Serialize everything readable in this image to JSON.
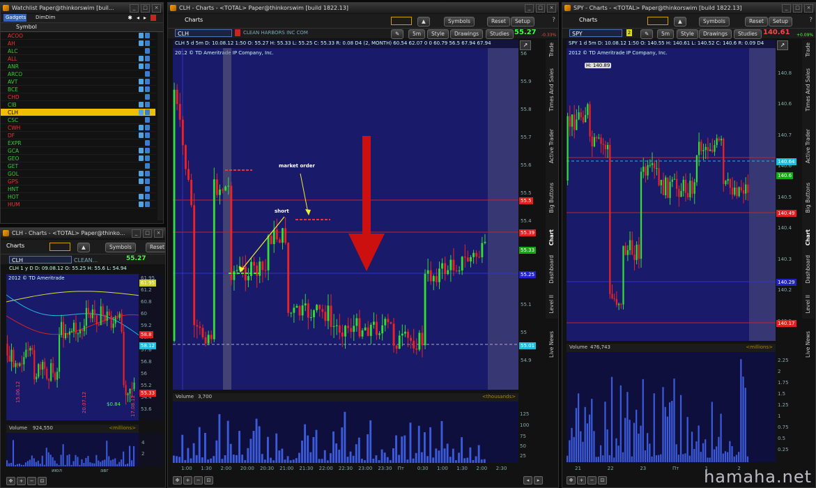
{
  "watchlist": {
    "title": "Watchlist Paper@thinkorswim [buil...",
    "gadgets_label": "Gadgets",
    "dimdim_label": "DimDim",
    "header": "Symbol",
    "rows": [
      {
        "sym": "ACOO",
        "color": "#e33"
      },
      {
        "sym": "AH",
        "color": "#e33"
      },
      {
        "sym": "ALC",
        "color": "#3c3"
      },
      {
        "sym": "ALL",
        "color": "#e33"
      },
      {
        "sym": "ANR",
        "color": "#3c3"
      },
      {
        "sym": "ARCO",
        "color": "#3c3"
      },
      {
        "sym": "AVT",
        "color": "#3c3"
      },
      {
        "sym": "BCE",
        "color": "#3c3"
      },
      {
        "sym": "CHD",
        "color": "#e33"
      },
      {
        "sym": "CIB",
        "color": "#3c3"
      },
      {
        "sym": "CLH",
        "color": "#000",
        "selected": true
      },
      {
        "sym": "CSC",
        "color": "#3c3"
      },
      {
        "sym": "CWH",
        "color": "#e33"
      },
      {
        "sym": "DF",
        "color": "#e33"
      },
      {
        "sym": "EXPR",
        "color": "#3c3"
      },
      {
        "sym": "GCA",
        "color": "#3c3"
      },
      {
        "sym": "GEO",
        "color": "#3c3"
      },
      {
        "sym": "GET",
        "color": "#3c3"
      },
      {
        "sym": "GOL",
        "color": "#3c3"
      },
      {
        "sym": "GPS",
        "color": "#e33"
      },
      {
        "sym": "HNT",
        "color": "#3c3"
      },
      {
        "sym": "HOT",
        "color": "#3c3"
      },
      {
        "sym": "HUM",
        "color": "#e33"
      }
    ]
  },
  "small_chart": {
    "title": "CLH - Charts - <TOTAL> Paper@thinko...",
    "charts_tab": "Charts",
    "symbols_btn": "Symbols",
    "reset_btn": "Reset",
    "symbol": "CLH",
    "company": "CLEAN...",
    "last": "55.27",
    "info": "CLH 1 y D  D: 09.08.12  O: 55.25  H: 55.6  L: 54.94",
    "copyright": "2012 © TD Ameritrade",
    "price_ticks": [
      "61.95",
      "61.2",
      "60.8",
      "60",
      "59.2",
      "58.4",
      "57.6",
      "56.8",
      "56",
      "55.2",
      "54.4",
      "53.6"
    ],
    "tags": [
      {
        "v": "61.95",
        "c": "#cc3"
      },
      {
        "v": "58.8",
        "c": "#d22"
      },
      {
        "v": "58.12",
        "c": "#2bd"
      },
      {
        "v": "55.33",
        "c": "#d22"
      }
    ],
    "annot_1": "15.06.12",
    "annot_2": "20.07.12",
    "annot_3": "17.08.12",
    "annot_val": "$0.84",
    "volume_label": "Volume",
    "volume_value": "924,550",
    "volume_units": "<millions>",
    "vol_ticks": [
      "4",
      "2"
    ],
    "time_ticks": [
      "июл",
      "авг"
    ]
  },
  "main_chart": {
    "title": "CLH - Charts - <TOTAL> Paper@thinkorswim [build 1822.13]",
    "charts_tab": "Charts",
    "symbols_btn": "Symbols",
    "reset_btn": "Reset",
    "setup_btn": "Setup",
    "symbol": "CLH",
    "company": "CLEAN HARBORS INC COM",
    "interval": "5m",
    "style_btn": "Style",
    "drawings_btn": "Drawings",
    "studies_btn": "Studies",
    "last": "55.27",
    "change": "-0.33%",
    "info": "CLH 5 d 5m   D: 10.08.12 1:50   O: 55.27   H: 55.33   L: 55.25   C: 55.33   R: 0.08   D4 (2, MONTH)   60.54  62.07  0  0  60.79  56.5  67.94  67.94",
    "copyright": "2012 © TD Ameritrade IP Company, Inc.",
    "price_ticks": [
      "56",
      "55.9",
      "55.8",
      "55.7",
      "55.6",
      "55.5",
      "55.4",
      "55.3",
      "55.2",
      "55.1",
      "55",
      "54.9"
    ],
    "tags": [
      {
        "v": "55.5",
        "c": "#d22"
      },
      {
        "v": "55.39",
        "c": "#d22"
      },
      {
        "v": "55.33",
        "c": "#1a1"
      },
      {
        "v": "55.25",
        "c": "#22c"
      },
      {
        "v": "55.01",
        "c": "#2bd"
      }
    ],
    "annot_short": "short",
    "annot_market": "market order",
    "volume_label": "Volume",
    "volume_value": "3,700",
    "volume_units": "<thousands>",
    "vol_ticks": [
      "125",
      "100",
      "75",
      "50",
      "25"
    ],
    "time_ticks": [
      "1:00",
      "1:30",
      "2:00",
      "20:00",
      "20:30",
      "21:00",
      "21:30",
      "22:00",
      "22:30",
      "23:00",
      "23:30",
      "Пт",
      "0:30",
      "1:00",
      "1:30",
      "2:00",
      "2:30"
    ],
    "side_tabs": [
      "Trade",
      "Times And Sales",
      "Active Trader",
      "Big Buttons",
      "Chart",
      "Dashboard",
      "Level II",
      "Live News"
    ]
  },
  "spy_chart": {
    "title": "SPY - Charts - <TOTAL> Paper@thinkorswim [build 1822.13]",
    "charts_tab": "Charts",
    "symbols_btn": "Symbols",
    "reset_btn": "Reset",
    "setup_btn": "Setup",
    "symbol": "SPY",
    "interval": "5m",
    "style_btn": "Style",
    "drawings_btn": "Drawings",
    "studies_btn": "Studies",
    "last": "140.61",
    "change": "+0.09%",
    "info": "SPY 1 d 5m   D: 10.08.12 1:50   O: 140.55   H: 140.61   L: 140.52   C: 140.6   R: 0.09   D4",
    "copyright": "2012 © TD Ameritrade IP Company, Inc.",
    "high_label": "H: 140.89",
    "price_ticks": [
      "140.8",
      "140.6",
      "140.7",
      "140.6",
      "140.5",
      "140.4",
      "140.3",
      "140.2",
      "140.1"
    ],
    "tags": [
      {
        "v": "140.64",
        "c": "#2bd"
      },
      {
        "v": "140.6",
        "c": "#1a1"
      },
      {
        "v": "140.49",
        "c": "#d22"
      },
      {
        "v": "140.29",
        "c": "#22c"
      },
      {
        "v": "140.17",
        "c": "#d22"
      }
    ],
    "volume_label": "Volume",
    "volume_value": "476,743",
    "volume_units": "<millions>",
    "vol_ticks": [
      "2.25",
      "2",
      "1.75",
      "1.5",
      "1.25",
      "1",
      "0.75",
      "0.5",
      "0.25"
    ],
    "time_ticks": [
      "21",
      "22",
      "23",
      "Пт",
      "1",
      "2"
    ],
    "side_tabs": [
      "Trade",
      "Times And Sales",
      "Active Trader",
      "Big Buttons",
      "Chart",
      "Dashboard",
      "Level II",
      "Live News"
    ]
  },
  "watermark": "hamaha.net"
}
